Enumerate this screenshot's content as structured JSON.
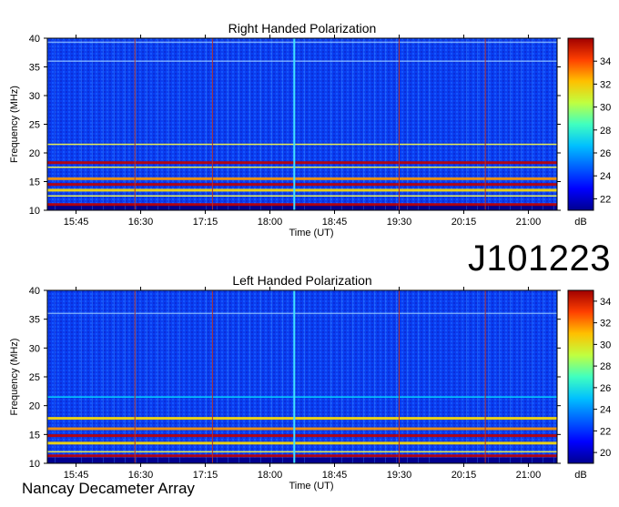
{
  "big_label": "J101223",
  "footer_label": "Nancay Decameter Array",
  "chart_data": [
    {
      "type": "heatmap",
      "title": "Right Handed Polarization",
      "xlabel": "Time (UT)",
      "ylabel": "Frequency (MHz)",
      "x_ticks": [
        "15:45",
        "16:30",
        "17:15",
        "18:00",
        "18:45",
        "19:30",
        "20:15",
        "21:00"
      ],
      "y_ticks": [
        10,
        15,
        20,
        25,
        30,
        35,
        40
      ],
      "ylim": [
        10,
        40
      ],
      "colorbar": {
        "label": "dB",
        "range": [
          21,
          36
        ],
        "ticks": [
          22,
          24,
          26,
          28,
          30,
          32,
          34
        ],
        "colors": [
          "#000090",
          "#0000ff",
          "#0060ff",
          "#00c0ff",
          "#40ffc0",
          "#c0ff40",
          "#ffc000",
          "#ff4000",
          "#a00000"
        ]
      },
      "bands": [
        {
          "freq": 11.0,
          "level": "high"
        },
        {
          "freq": 12.5,
          "level": "mid"
        },
        {
          "freq": 13.5,
          "level": "high"
        },
        {
          "freq": 14.5,
          "level": "high"
        },
        {
          "freq": 15.5,
          "level": "high"
        },
        {
          "freq": 17.5,
          "level": "mid"
        },
        {
          "freq": 18.3,
          "level": "high"
        },
        {
          "freq": 21.5,
          "level": "mid"
        },
        {
          "freq": 36.0,
          "level": "low"
        },
        {
          "freq": 39.3,
          "level": "low"
        }
      ],
      "time_lines": [
        "16:26",
        "17:20",
        "18:17",
        "19:30",
        "20:30"
      ]
    },
    {
      "type": "heatmap",
      "title": "Left Handed Polarization",
      "xlabel": "Time (UT)",
      "ylabel": "Frequency (MHz)",
      "x_ticks": [
        "15:45",
        "16:30",
        "17:15",
        "18:00",
        "18:45",
        "19:30",
        "20:15",
        "21:00"
      ],
      "y_ticks": [
        10,
        15,
        20,
        25,
        30,
        35,
        40
      ],
      "ylim": [
        10,
        40
      ],
      "colorbar": {
        "label": "dB",
        "range": [
          19,
          35
        ],
        "ticks": [
          20,
          22,
          24,
          26,
          28,
          30,
          32,
          34
        ],
        "colors": [
          "#000090",
          "#0000ff",
          "#0060ff",
          "#00c0ff",
          "#40ffc0",
          "#c0ff40",
          "#ffc000",
          "#ff4000",
          "#a00000"
        ]
      },
      "bands": [
        {
          "freq": 11.3,
          "level": "high"
        },
        {
          "freq": 12.0,
          "level": "mid"
        },
        {
          "freq": 13.5,
          "level": "high"
        },
        {
          "freq": 14.8,
          "level": "high"
        },
        {
          "freq": 16.0,
          "level": "high"
        },
        {
          "freq": 17.8,
          "level": "high"
        },
        {
          "freq": 21.5,
          "level": "mid"
        },
        {
          "freq": 36.0,
          "level": "low"
        }
      ],
      "time_lines": [
        "16:26",
        "17:20",
        "18:17",
        "19:30",
        "20:30"
      ]
    }
  ]
}
